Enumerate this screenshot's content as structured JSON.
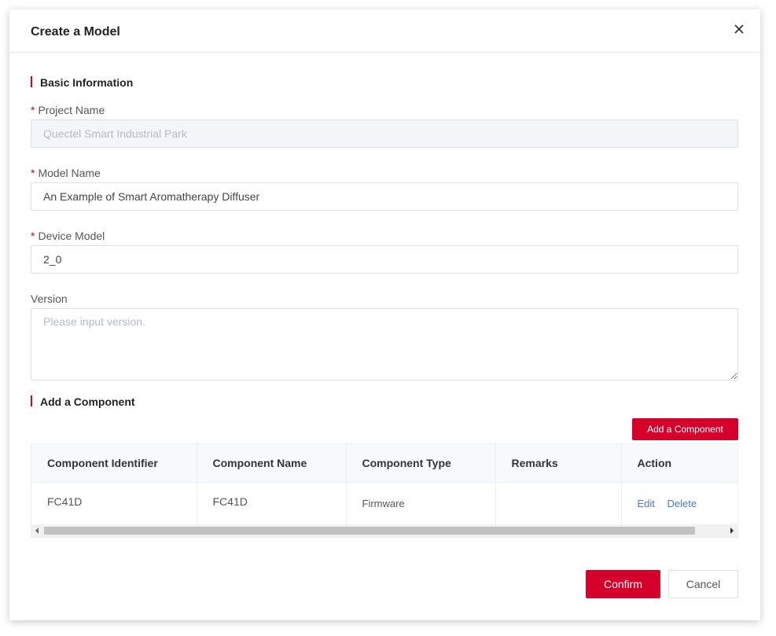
{
  "dialog": {
    "title": "Create a Model",
    "close_icon": "close-icon"
  },
  "basic_info": {
    "section_title": "Basic Information",
    "project_name": {
      "label": "Project Name",
      "required_mark": "*",
      "value": "Quectel Smart Industrial Park",
      "disabled": true
    },
    "model_name": {
      "label": "Model Name",
      "required_mark": "*",
      "value": "An Example of Smart Aromatherapy Diffuser"
    },
    "device_model": {
      "label": "Device Model",
      "required_mark": "*",
      "value": "2_0"
    },
    "version": {
      "label": "Version",
      "placeholder": "Please input version.",
      "value": ""
    }
  },
  "components": {
    "section_title": "Add a Component",
    "add_button_label": "Add a Component",
    "columns": [
      "Component Identifier",
      "Component Name",
      "Component Type",
      "Remarks",
      "Action"
    ],
    "rows": [
      {
        "identifier": "FC41D",
        "name": "FC41D",
        "type": "Firmware",
        "remarks": "",
        "actions": {
          "edit": "Edit",
          "delete": "Delete"
        }
      }
    ]
  },
  "footer": {
    "confirm_label": "Confirm",
    "cancel_label": "Cancel"
  },
  "colors": {
    "accent": "#d4002b",
    "link": "#4a78c9"
  }
}
